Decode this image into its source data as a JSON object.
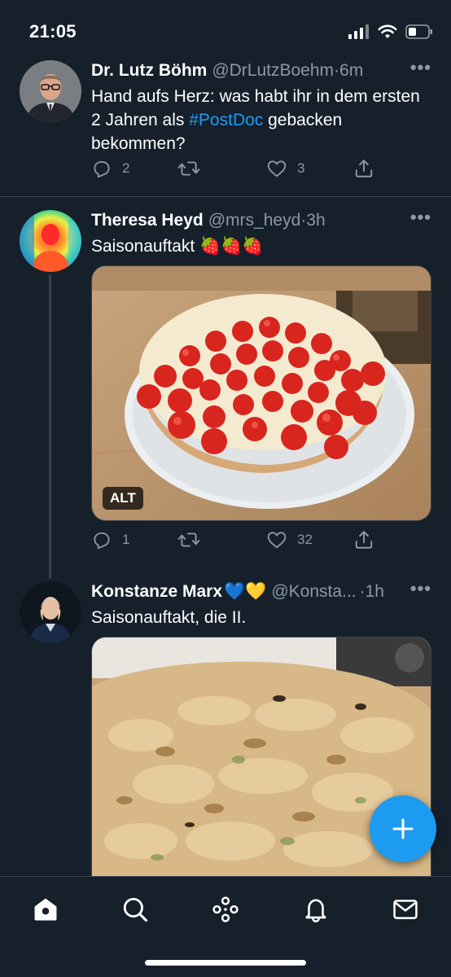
{
  "status_bar": {
    "time": "21:05"
  },
  "tweets": [
    {
      "name": "Dr. Lutz Böhm",
      "handle": "@DrLutzBoehm",
      "separator": "·",
      "time": "6m",
      "text_before": "Hand aufs Herz: was habt ihr in dem ersten 2 Jahren als ",
      "hashtag": "#PostDoc",
      "text_after": " gebacken bekommen?",
      "replies": "2",
      "retweets": "",
      "likes": "3"
    },
    {
      "name": "Theresa Heyd",
      "handle": "@mrs_heyd",
      "separator": "·",
      "time": "3h",
      "text": "Saisonauftakt",
      "emoji": "🍓🍓🍓",
      "media_alt_badge": "ALT",
      "replies": "1",
      "retweets": "",
      "likes": "32"
    },
    {
      "name": "Konstanze Marx",
      "name_emoji": "💙💛",
      "handle": "@Konsta...",
      "separator": "·",
      "time": "1h",
      "text": "Saisonauftakt, die II."
    }
  ],
  "more_glyph": "•••",
  "icons": {
    "reply": "reply-icon",
    "retweet": "retweet-icon",
    "like": "heart-icon",
    "share": "share-icon",
    "compose": "plus-icon",
    "nav": [
      "home-icon",
      "search-icon",
      "spaces-icon",
      "notifications-icon",
      "messages-icon"
    ]
  },
  "colors": {
    "background": "#15202b",
    "accent": "#1d9bf0",
    "secondary_text": "#8b98a5",
    "divider": "#38444d"
  }
}
